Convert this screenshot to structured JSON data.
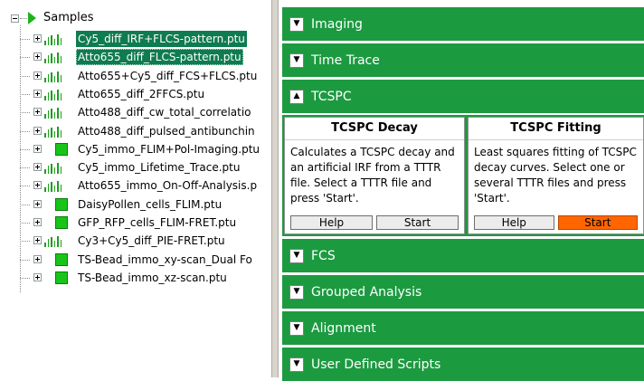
{
  "tree": {
    "root_label": "Samples",
    "items": [
      {
        "label": "Cy5_diff_IRF+FLCS-pattern.ptu",
        "icon": "histogram-icon",
        "state": "selected"
      },
      {
        "label": "Atto655_diff_FLCS-pattern.ptu",
        "icon": "histogram-icon",
        "state": "focused"
      },
      {
        "label": "Atto655+Cy5_diff_FCS+FLCS.ptu",
        "icon": "histogram-icon",
        "state": ""
      },
      {
        "label": "Atto655_diff_2FFCS.ptu",
        "icon": "histogram-icon",
        "state": ""
      },
      {
        "label": "Atto488_diff_cw_total_correlatio",
        "icon": "histogram-icon",
        "state": ""
      },
      {
        "label": "Atto488_diff_pulsed_antibunchin",
        "icon": "histogram-icon",
        "state": ""
      },
      {
        "label": "Cy5_immo_FLIM+Pol-Imaging.ptu",
        "icon": "image-square-icon",
        "state": ""
      },
      {
        "label": "Cy5_immo_Lifetime_Trace.ptu",
        "icon": "histogram-icon",
        "state": ""
      },
      {
        "label": "Atto655_immo_On-Off-Analysis.p",
        "icon": "histogram-icon",
        "state": ""
      },
      {
        "label": "DaisyPollen_cells_FLIM.ptu",
        "icon": "image-square-icon",
        "state": ""
      },
      {
        "label": "GFP_RFP_cells_FLIM-FRET.ptu",
        "icon": "image-square-icon",
        "state": ""
      },
      {
        "label": "Cy3+Cy5_diff_PIE-FRET.ptu",
        "icon": "histogram-icon",
        "state": ""
      },
      {
        "label": "TS-Bead_immo_xy-scan_Dual Fo",
        "icon": "image-square-icon",
        "state": ""
      },
      {
        "label": "TS-Bead_immo_xz-scan.ptu",
        "icon": "image-square-icon",
        "state": ""
      }
    ]
  },
  "sections": {
    "imaging": {
      "label": "Imaging",
      "toggle": "▼"
    },
    "time_trace": {
      "label": "Time Trace",
      "toggle": "▼"
    },
    "tcspc": {
      "label": "TCSPC",
      "toggle": "▲"
    },
    "fcs": {
      "label": "FCS",
      "toggle": "▼"
    },
    "grouped": {
      "label": "Grouped Analysis",
      "toggle": "▼"
    },
    "alignment": {
      "label": "Alignment",
      "toggle": "▼"
    },
    "user_scripts": {
      "label": "User Defined Scripts",
      "toggle": "▼"
    }
  },
  "tcspc_cards": {
    "decay": {
      "title": "TCSPC Decay",
      "description": "Calculates a TCSPC decay and an artificial IRF from a TTTR file. Select a TTTR file and press 'Start'.",
      "help": "Help",
      "start": "Start"
    },
    "fitting": {
      "title": "TCSPC Fitting",
      "description": "Least squares fitting of TCSPC decay curves. Select one or several TTTR files and press 'Start'.",
      "help": "Help",
      "start": "Start"
    }
  },
  "colors": {
    "section_bar": "#1c9a40",
    "selection": "#0f7b50",
    "start_highlight": "#ff6600"
  }
}
